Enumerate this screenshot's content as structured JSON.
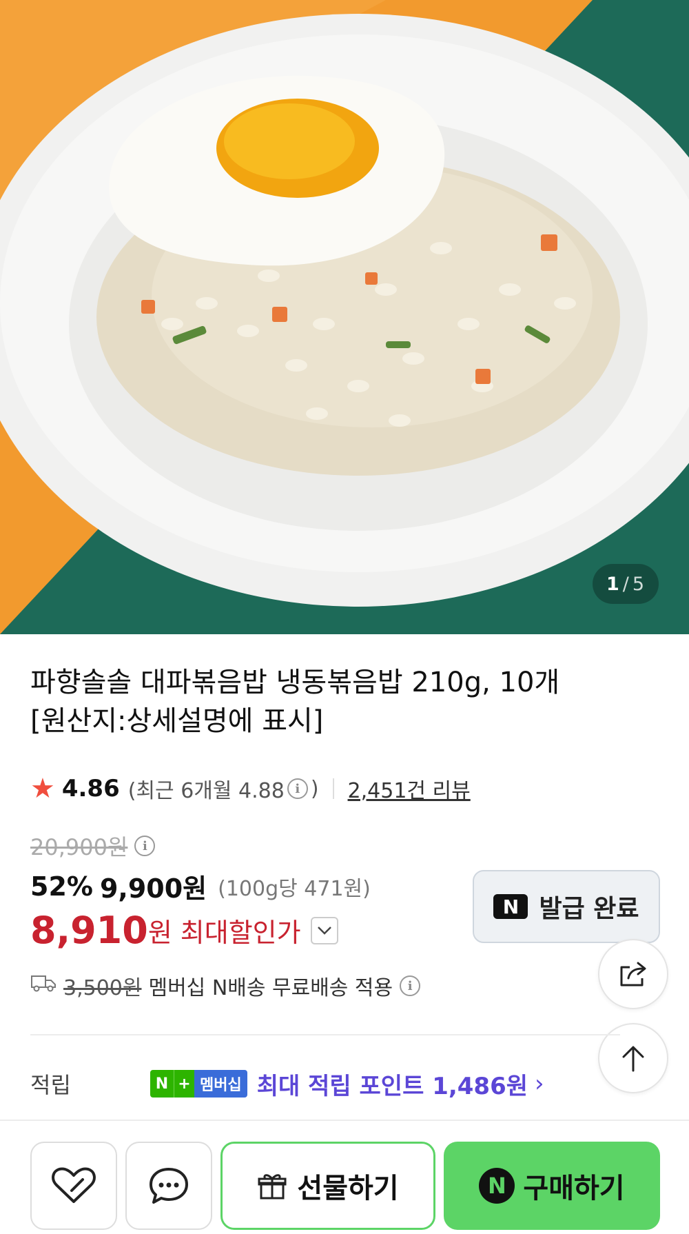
{
  "gallery": {
    "current": "1",
    "total": "5"
  },
  "product": {
    "title_line1": "파향솔솔 대파볶음밥 냉동볶음밥 210g, 10개",
    "title_line2": "[원산지:상세설명에 표시]"
  },
  "rating": {
    "score": "4.86",
    "recent_prefix": "(최근 6개월 4.88",
    "recent_suffix": ")",
    "reviews": "2,451건 리뷰"
  },
  "price": {
    "original": "20,900원",
    "discount": "52%",
    "sale": "9,900원",
    "unit_price": "(100g당 471원)",
    "max_price": "8,910",
    "max_won": "원",
    "max_label": "최대할인가"
  },
  "coupon": {
    "label": "발급 완료",
    "badge": "N"
  },
  "shipping": {
    "fee": "3,500원",
    "text": "멤버십 N배송 무료배송 적용"
  },
  "points": {
    "label": "적립",
    "badge_n": "N",
    "badge_plus": "+",
    "badge_member": "멤버십",
    "text": "최대 적립 포인트 1,486원",
    "chevron": "›"
  },
  "actions": {
    "gift": "선물하기",
    "buy": "구매하기",
    "buy_badge": "N"
  },
  "colors": {
    "accent_green": "#5cd466",
    "price_red": "#c8222f",
    "points_purple": "#5b46d6",
    "star": "#f04e3e"
  }
}
